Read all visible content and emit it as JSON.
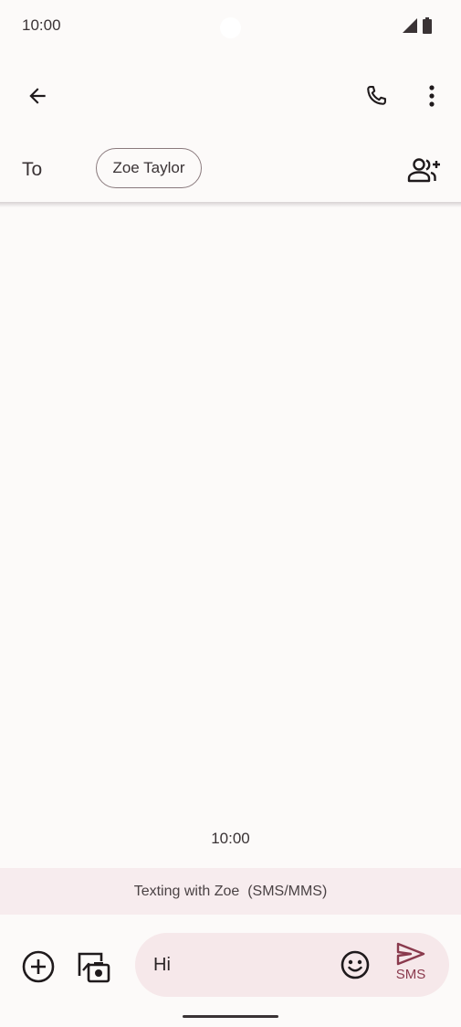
{
  "status_bar": {
    "time": "10:00"
  },
  "header": {
    "back": "back",
    "call": "call",
    "more": "more options"
  },
  "recipients": {
    "to_label": "To",
    "chip": "Zoe Taylor"
  },
  "conversation": {
    "timestamp": "10:00"
  },
  "banner": {
    "text": "Texting with Zoe  (SMS/MMS)"
  },
  "compose": {
    "text": "Hi",
    "send_label": "SMS"
  },
  "colors": {
    "accent": "#8a3a4d",
    "background": "#fcfaf9",
    "banner_bg": "#f7ecee",
    "compose_bg": "#f6e8ea"
  },
  "icons": {
    "back": "arrow-left-icon",
    "call": "phone-icon",
    "more": "more-vert-icon",
    "add_contact": "person-add-icon",
    "plus": "add-circle-icon",
    "media": "gallery-camera-icon",
    "emoji": "emoji-icon",
    "send": "send-icon",
    "signal": "signal-icon",
    "battery": "battery-icon"
  }
}
